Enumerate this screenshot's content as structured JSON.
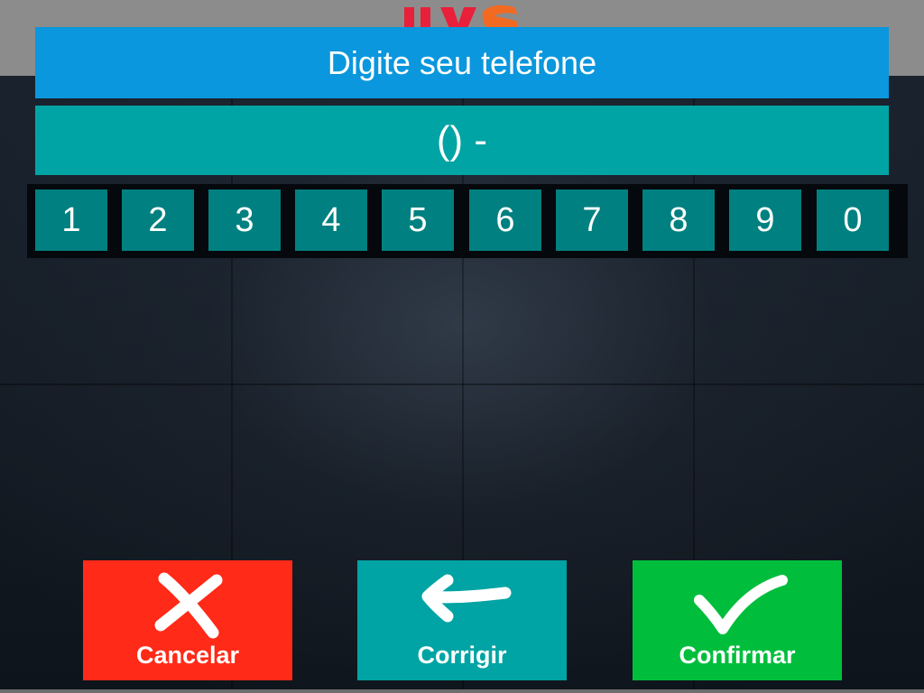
{
  "header": {
    "title": "Digite seu telefone"
  },
  "phone": {
    "value": "() -"
  },
  "keypad": {
    "keys": [
      "1",
      "2",
      "3",
      "4",
      "5",
      "6",
      "7",
      "8",
      "9",
      "0"
    ]
  },
  "actions": {
    "cancel_label": "Cancelar",
    "correct_label": "Corrigir",
    "confirm_label": "Confirmar"
  },
  "icons": {
    "cancel": "close-icon",
    "correct": "arrow-left-icon",
    "confirm": "checkmark-icon"
  },
  "colors": {
    "title_bar": "#0a97dd",
    "phone_display": "#00a4a4",
    "keys": "#008080",
    "cancel": "#ff2a17",
    "correct": "#00a4a4",
    "confirm": "#00be3c",
    "top_strip": "#8c8c8c"
  }
}
